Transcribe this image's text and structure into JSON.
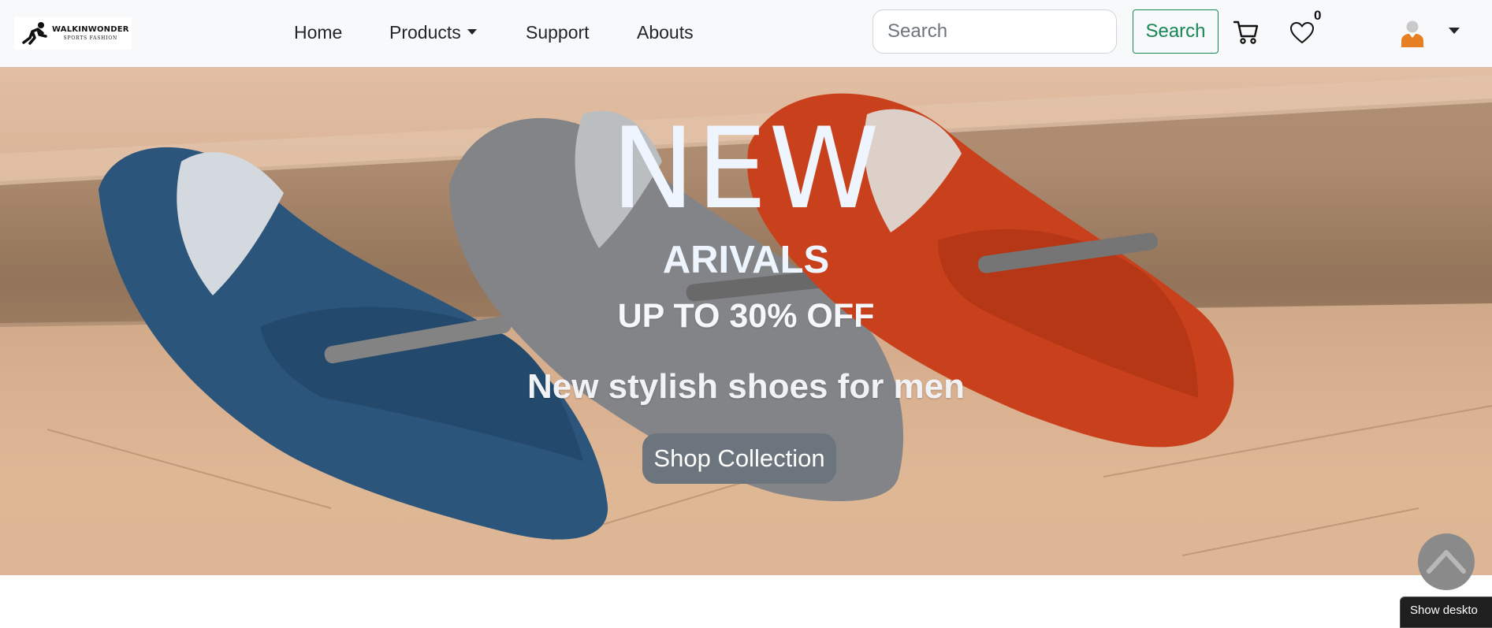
{
  "brand": {
    "name": "WALKINWONDER",
    "tagline": "SPORTS FASHION"
  },
  "nav": {
    "home": "Home",
    "products": "Products",
    "support": "Support",
    "abouts": "Abouts"
  },
  "search": {
    "placeholder": "Search",
    "button_label": "Search"
  },
  "wishlist": {
    "count": "0"
  },
  "hero": {
    "headline": "NEW",
    "subheadline": "ARIVALS",
    "offer": "UP TO 30% OFF",
    "tagline": "New stylish shoes for men",
    "cta_label": "Shop Collection"
  },
  "tooltip": {
    "text": "Show deskto"
  },
  "colors": {
    "navbar_bg": "#f8f9fa",
    "search_btn": "#198754",
    "cta_bg": "#6c757d",
    "hero_text": "#eef5ff",
    "avatar": "#e67e22"
  },
  "icons": {
    "cart": "cart-icon",
    "wishlist": "heart-icon",
    "user": "avatar-icon",
    "scroll_top": "chevron-up-icon"
  }
}
